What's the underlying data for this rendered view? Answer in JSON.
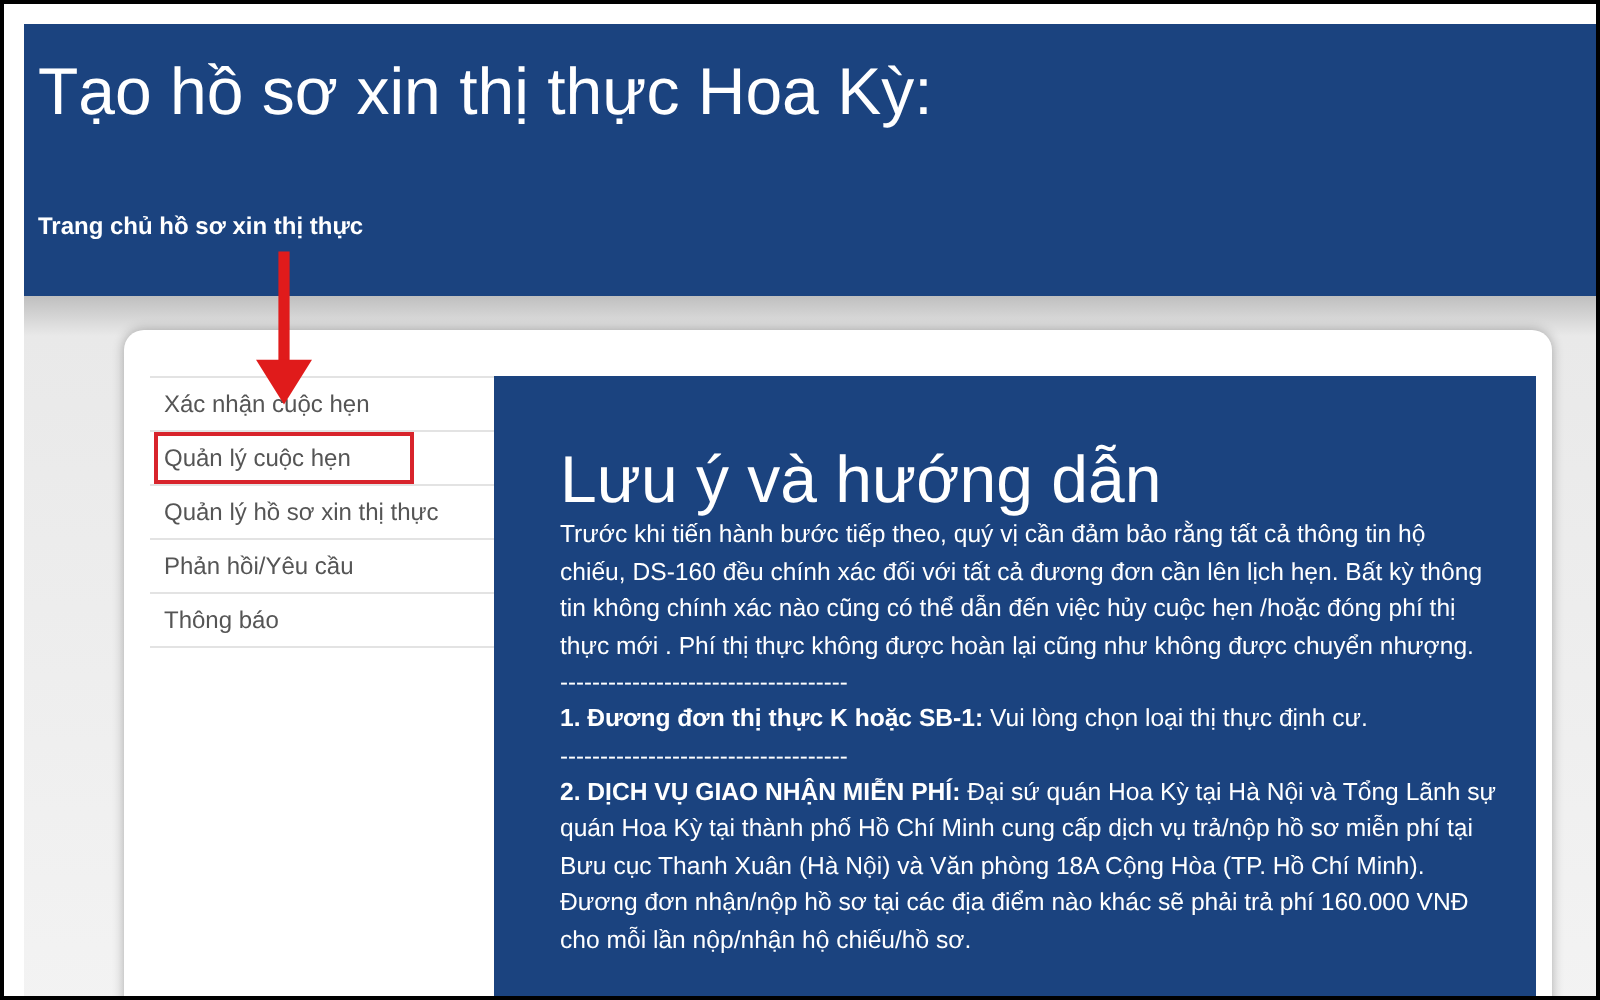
{
  "header": {
    "title": "Tạo hồ sơ xin thị thực Hoa Kỳ:",
    "breadcrumb": "Trang chủ hồ sơ xin thị thực"
  },
  "sidebar": {
    "items": [
      {
        "label": "Xác nhận cuộc hẹn",
        "highlighted": false
      },
      {
        "label": "Quản lý cuộc hẹn",
        "highlighted": true
      },
      {
        "label": "Quản lý hồ sơ xin thị thực",
        "highlighted": false
      },
      {
        "label": "Phản hồi/Yêu cầu",
        "highlighted": false
      },
      {
        "label": "Thông báo",
        "highlighted": false
      }
    ]
  },
  "content": {
    "heading": "Lưu ý và hướng dẫn",
    "paragraphs": [
      {
        "kind": "text",
        "text": "Trước khi tiến hành bước tiếp theo, quý vị cần đảm bảo rằng tất cả thông tin hộ chiếu, DS-160 đều chính xác đối với tất cả đương đơn cần lên lịch hẹn. Bất kỳ thông tin không chính xác nào cũng có thể dẫn đến việc hủy cuộc hẹn /hoặc đóng phí thị thực mới . Phí thị thực không được hoàn lại cũng như không được chuyển nhượng."
      },
      {
        "kind": "separator",
        "text": "------------------------------------"
      },
      {
        "kind": "text",
        "text": "**1. Đương đơn thị thực K hoặc SB-1:** Vui lòng chọn loại thị thực định cư."
      },
      {
        "kind": "separator",
        "text": "------------------------------------"
      },
      {
        "kind": "text",
        "text": "**2. DỊCH VỤ GIAO NHẬN MIỄN PHÍ:** Đại sứ quán Hoa Kỳ tại Hà Nội và Tổng Lãnh sự quán Hoa Kỳ tại thành phố Hồ Chí Minh cung cấp dịch vụ trả/nộp hồ sơ miễn phí tại Bưu cục Thanh Xuân (Hà Nội) và Văn phòng 18A Cộng Hòa (TP. Hồ Chí Minh). Đương đơn nhận/nộp hồ sơ tại các địa điểm nào khác sẽ phải trả phí 160.000 VNĐ cho mỗi lần nộp/nhận hộ chiếu/hồ sơ."
      }
    ]
  }
}
